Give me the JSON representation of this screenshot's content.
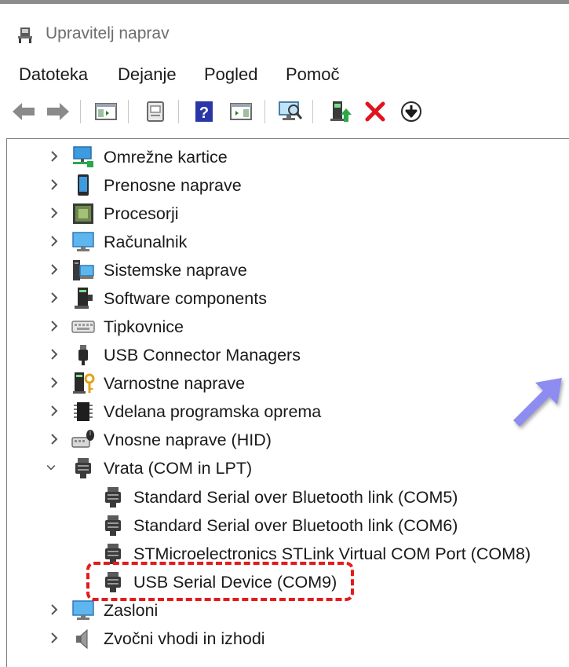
{
  "window": {
    "title": "Upravitelj naprav",
    "app_icon": "device-manager-icon"
  },
  "menu": [
    "Datoteka",
    "Dejanje",
    "Pogled",
    "Pomoč"
  ],
  "toolbar": {
    "buttons": [
      "back-arrow-icon",
      "forward-arrow-icon",
      "show-hide-console-tree-icon",
      "properties-icon",
      "help-icon",
      "action-pane-icon",
      "scan-hardware-icon",
      "update-driver-icon",
      "uninstall-device-icon",
      "disable-device-icon"
    ]
  },
  "tree": {
    "categories_top": [
      {
        "label": "Omrežne kartice",
        "icon": "network-adapter-icon"
      },
      {
        "label": "Prenosne naprave",
        "icon": "portable-device-icon"
      },
      {
        "label": "Procesorji",
        "icon": "processor-icon"
      },
      {
        "label": "Računalnik",
        "icon": "computer-icon"
      },
      {
        "label": "Sistemske naprave",
        "icon": "system-devices-icon"
      },
      {
        "label": "Software components",
        "icon": "software-component-icon"
      },
      {
        "label": "Tipkovnice",
        "icon": "keyboard-icon"
      },
      {
        "label": "USB Connector Managers",
        "icon": "usb-connector-icon"
      },
      {
        "label": "Varnostne naprave",
        "icon": "security-device-icon"
      },
      {
        "label": "Vdelana programska oprema",
        "icon": "firmware-icon"
      },
      {
        "label": "Vnosne naprave (HID)",
        "icon": "hid-icon"
      }
    ],
    "expanded_category": {
      "label": "Vrata (COM in LPT)",
      "icon": "port-icon"
    },
    "ports": [
      {
        "label": "Standard Serial over Bluetooth link (COM5)"
      },
      {
        "label": "Standard Serial over Bluetooth link (COM6)"
      },
      {
        "label": "STMicroelectronics STLink Virtual COM Port (COM8)"
      },
      {
        "label": "USB Serial Device (COM9)",
        "highlighted": true
      }
    ],
    "categories_bottom": [
      {
        "label": "Zasloni",
        "icon": "monitor-icon"
      },
      {
        "label": "Zvočni vhodi in izhodi",
        "icon": "speaker-icon"
      }
    ]
  },
  "colors": {
    "highlight": "#e31b1b",
    "overlay_arrow": "#8d8cf0"
  }
}
